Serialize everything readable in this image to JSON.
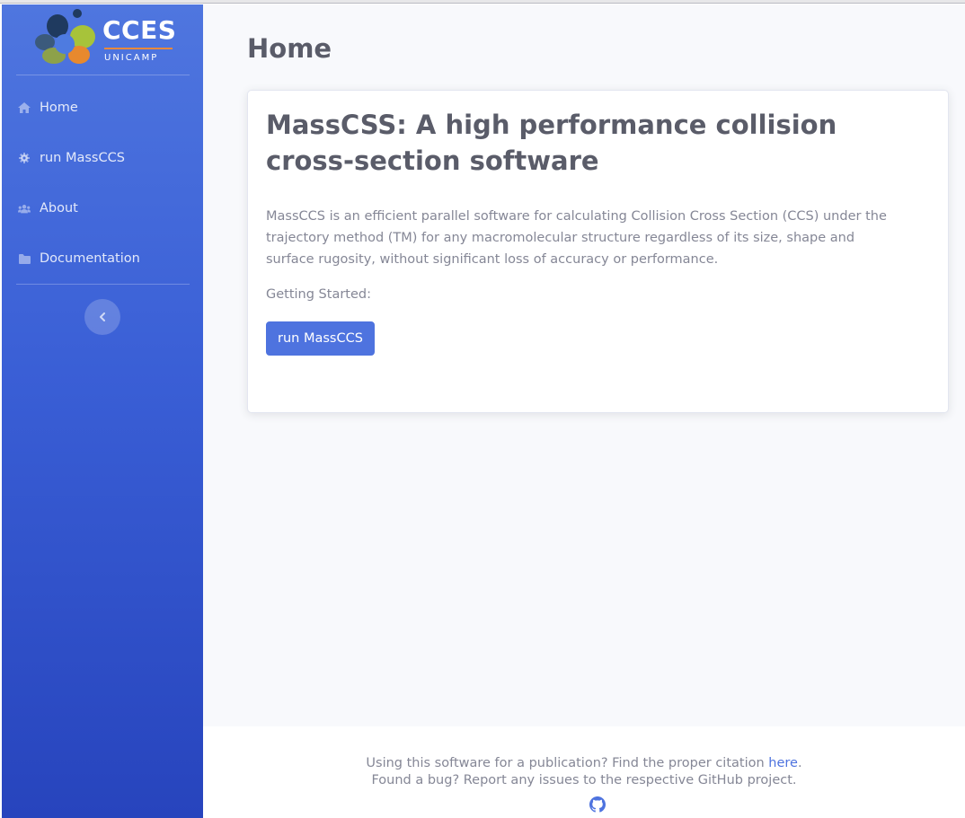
{
  "brand": {
    "name": "CCES",
    "subtitle": "UNICAMP"
  },
  "sidebar": {
    "items": [
      {
        "label": "Home",
        "icon": "home-icon"
      },
      {
        "label": "run MassCCS",
        "icon": "gear-icon"
      },
      {
        "label": "About",
        "icon": "users-icon"
      },
      {
        "label": "Documentation",
        "icon": "folder-icon"
      }
    ],
    "collapse_icon": "chevron-left-icon"
  },
  "main": {
    "page_title": "Home",
    "card": {
      "heading": "MassCSS: A high performance collision cross-section software",
      "description": "MassCCS is an efficient parallel software for calculating Collision Cross Section (CCS) under the trajectory method (TM) for any macromolecular structure regardless of its size, shape and surface rugosity, without significant loss of accuracy or performance.",
      "getting_started": "Getting Started:",
      "button_label": "run MassCCS"
    }
  },
  "footer": {
    "line1_prefix": "Using this software for a publication? Find the proper citation ",
    "line1_link": "here",
    "line1_suffix": ".",
    "line2": "Found a bug? Report any issues to the respective GitHub project.",
    "icon": "github-icon"
  },
  "colors": {
    "primary": "#4e73df",
    "sidebar_top": "#4f76df",
    "sidebar_bottom": "#2744bd",
    "text_dark": "#5a5c69",
    "text_muted": "#858796",
    "page_bg": "#f8f9fc"
  }
}
